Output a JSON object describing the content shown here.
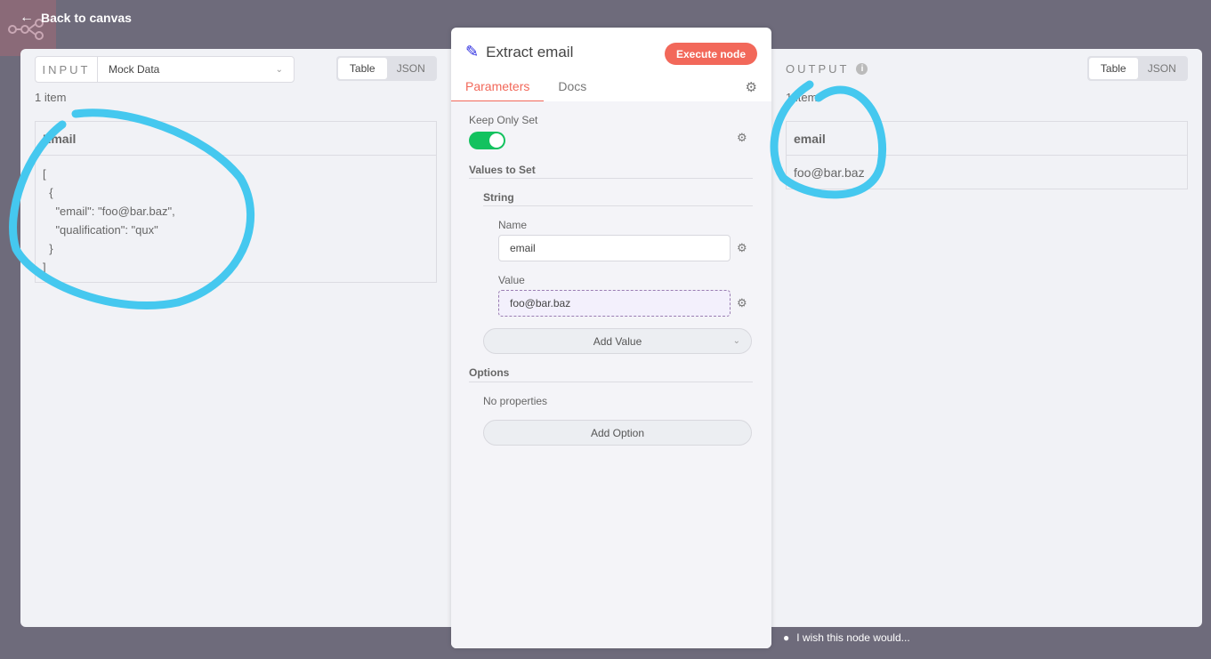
{
  "nav": {
    "back_label": "Back to canvas"
  },
  "input_pane": {
    "label": "INPUT",
    "node_select": "Mock Data",
    "view_options": [
      "Table",
      "JSON"
    ],
    "active_view": "Table",
    "item_count": "1 item",
    "column_header": "Email",
    "json_lines": [
      "[",
      "  {",
      "    \"email\": \"foo@bar.baz\",",
      "    \"qualification\": \"qux\"",
      "  }",
      "]"
    ]
  },
  "output_pane": {
    "label": "OUTPUT",
    "view_options": [
      "Table",
      "JSON"
    ],
    "active_view": "Table",
    "item_count": "1 item",
    "column_header": "email",
    "rows": [
      "foo@bar.baz"
    ]
  },
  "node": {
    "title": "Extract email",
    "execute_label": "Execute node",
    "tabs": [
      "Parameters",
      "Docs"
    ],
    "active_tab": "Parameters",
    "keep_only_set_label": "Keep Only Set",
    "keep_only_set_value": true,
    "values_to_set_label": "Values to Set",
    "string_label": "String",
    "name_label": "Name",
    "name_value": "email",
    "value_label": "Value",
    "value_value": "foo@bar.baz",
    "add_value_label": "Add Value",
    "options_label": "Options",
    "no_properties": "No properties",
    "add_option_label": "Add Option"
  },
  "footer": {
    "wish_label": "I wish this node would..."
  },
  "colors": {
    "accent": "#f2685a",
    "toggle_on": "#13c25f",
    "annotation": "#45c8ef",
    "backdrop": "#6e6b7b"
  }
}
